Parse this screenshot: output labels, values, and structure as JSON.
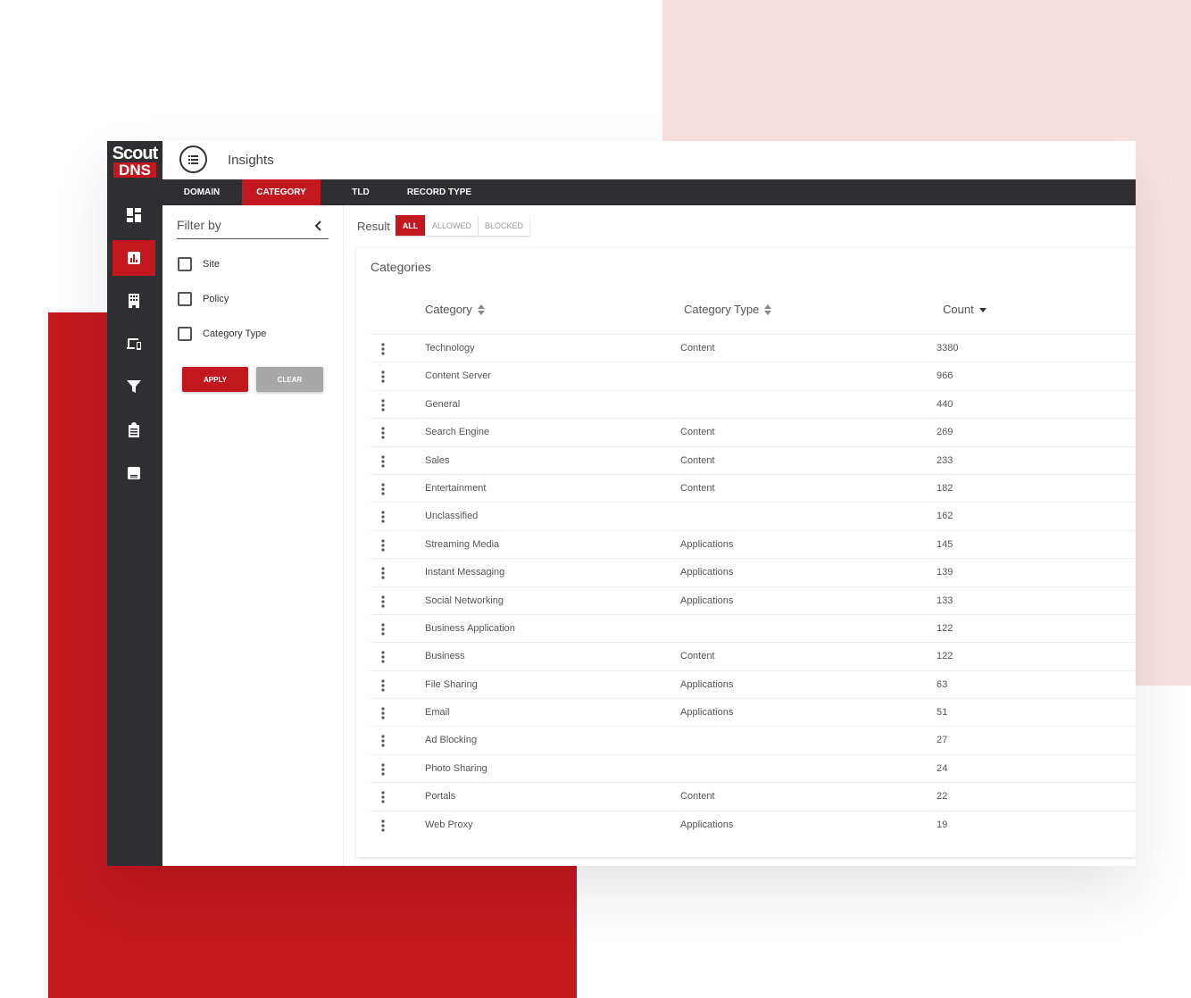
{
  "app": {
    "logo_line1": "Scout",
    "logo_line2": "DNS",
    "page_title": "Insights",
    "brand_color": "#c2171f"
  },
  "sidebar": {
    "items": [
      {
        "icon": "dashboard-icon",
        "active": false
      },
      {
        "icon": "insights-chart-icon",
        "active": true
      },
      {
        "icon": "building-icon",
        "active": false
      },
      {
        "icon": "devices-icon",
        "active": false
      },
      {
        "icon": "filter-icon",
        "active": false
      },
      {
        "icon": "clipboard-list-icon",
        "active": false
      },
      {
        "icon": "book-icon",
        "active": false
      }
    ]
  },
  "tabs": [
    {
      "label": "DOMAIN",
      "active": false
    },
    {
      "label": "CATEGORY",
      "active": true
    },
    {
      "label": "TLD",
      "active": false
    },
    {
      "label": "RECORD TYPE",
      "active": false
    }
  ],
  "filter": {
    "title": "Filter by",
    "options": [
      {
        "label": "Site",
        "checked": false
      },
      {
        "label": "Policy",
        "checked": false
      },
      {
        "label": "Category Type",
        "checked": false
      }
    ],
    "apply_label": "APPLY",
    "clear_label": "CLEAR"
  },
  "result": {
    "label": "Result",
    "options": [
      "ALL",
      "ALLOWED",
      "BLOCKED"
    ],
    "selected": "ALL"
  },
  "table": {
    "title": "Categories",
    "columns": [
      "Category",
      "Category Type",
      "Count"
    ],
    "rows": [
      {
        "category": "Technology",
        "type": "Content",
        "count": "3380"
      },
      {
        "category": "Content Server",
        "type": "",
        "count": "966"
      },
      {
        "category": "General",
        "type": "",
        "count": "440"
      },
      {
        "category": "Search Engine",
        "type": "Content",
        "count": "269"
      },
      {
        "category": "Sales",
        "type": "Content",
        "count": "233"
      },
      {
        "category": "Entertainment",
        "type": "Content",
        "count": "182"
      },
      {
        "category": "Unclassified",
        "type": "",
        "count": "162"
      },
      {
        "category": "Streaming Media",
        "type": "Applications",
        "count": "145"
      },
      {
        "category": "Instant Messaging",
        "type": "Applications",
        "count": "139"
      },
      {
        "category": "Social Networking",
        "type": "Applications",
        "count": "133"
      },
      {
        "category": "Business Application",
        "type": "",
        "count": "122"
      },
      {
        "category": "Business",
        "type": "Content",
        "count": "122"
      },
      {
        "category": "File Sharing",
        "type": "Applications",
        "count": "63"
      },
      {
        "category": "Email",
        "type": "Applications",
        "count": "51"
      },
      {
        "category": "Ad Blocking",
        "type": "",
        "count": "27"
      },
      {
        "category": "Photo Sharing",
        "type": "",
        "count": "24"
      },
      {
        "category": "Portals",
        "type": "Content",
        "count": "22"
      },
      {
        "category": "Web Proxy",
        "type": "Applications",
        "count": "19"
      }
    ]
  }
}
